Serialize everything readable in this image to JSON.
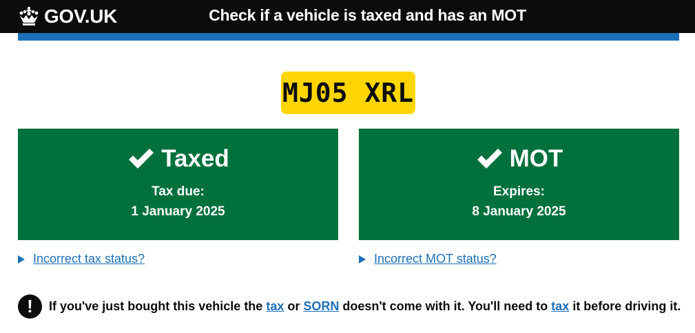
{
  "header": {
    "logo_text": "GOV.UK",
    "service_name": "Check if a vehicle is taxed and has an MOT"
  },
  "vehicle": {
    "registration": "MJ05 XRL"
  },
  "tax_panel": {
    "title": "Taxed",
    "label": "Tax due:",
    "date": "1 January 2025",
    "link": "Incorrect tax status?"
  },
  "mot_panel": {
    "title": "MOT",
    "label": "Expires:",
    "date": "8 January 2025",
    "link": "Incorrect MOT status?"
  },
  "warning": {
    "icon_text": "!",
    "text_1": "If you've just bought this vehicle the ",
    "link_tax_1": "tax",
    "text_2": " or ",
    "link_sorn": "SORN",
    "text_3": " doesn't come with it. You'll need to ",
    "link_tax_2": "tax",
    "text_4": " it before driving it."
  },
  "colors": {
    "header_bg": "#0b0c0c",
    "brand_blue": "#1d70b8",
    "plate_yellow": "#ffd500",
    "status_green": "#00703c"
  },
  "icons": {
    "logo": "crown-icon",
    "status": "tick-icon",
    "details": "triangle-right-icon",
    "warning": "exclamation-icon"
  }
}
